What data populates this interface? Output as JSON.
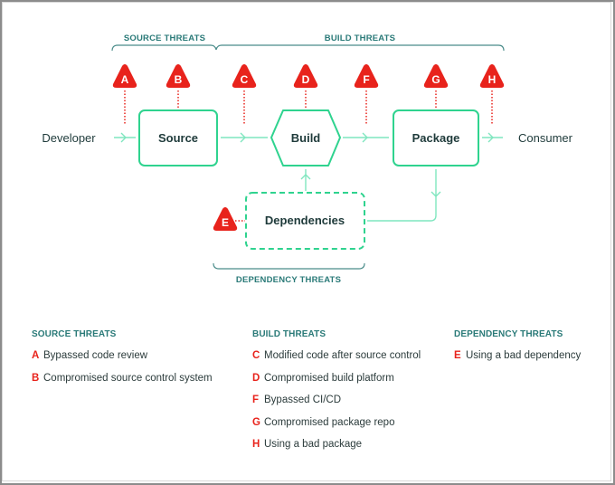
{
  "diagram": {
    "actors": {
      "developer": "Developer",
      "consumer": "Consumer"
    },
    "nodes": {
      "source": "Source",
      "build": "Build",
      "package": "Package",
      "dependencies": "Dependencies"
    },
    "groups": {
      "source": "SOURCE THREATS",
      "build": "BUILD THREATS",
      "dependency": "DEPENDENCY THREATS"
    },
    "threat_badges": [
      "A",
      "B",
      "C",
      "D",
      "F",
      "G",
      "H",
      "E"
    ],
    "colors": {
      "threat_red": "#e8231c",
      "node_border": "#2fd38f",
      "flow_line": "#7fe6bf",
      "group_label": "#2a7a78",
      "text_dark": "#1e3a3a"
    }
  },
  "legend": {
    "columns": [
      {
        "heading": "SOURCE THREATS",
        "items": [
          {
            "letter": "A",
            "text": "Bypassed code review"
          },
          {
            "letter": "B",
            "text": "Compromised source control system"
          }
        ]
      },
      {
        "heading": "BUILD THREATS",
        "items": [
          {
            "letter": "C",
            "text": "Modified code after source control"
          },
          {
            "letter": "D",
            "text": "Compromised build platform"
          },
          {
            "letter": "F",
            "text": "Bypassed CI/CD"
          },
          {
            "letter": "G",
            "text": "Compromised package repo"
          },
          {
            "letter": "H",
            "text": "Using a bad package"
          }
        ]
      },
      {
        "heading": "DEPENDENCY THREATS",
        "items": [
          {
            "letter": "E",
            "text": "Using a bad dependency"
          }
        ]
      }
    ]
  }
}
